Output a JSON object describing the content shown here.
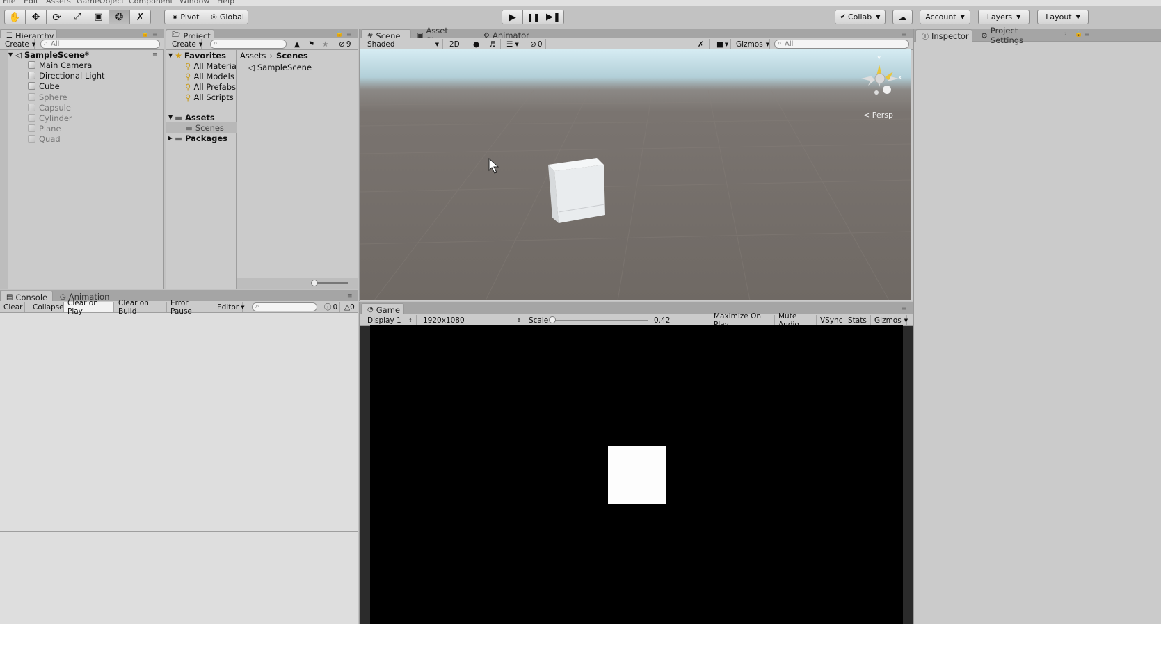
{
  "menu": [
    "File",
    "Edit",
    "Assets",
    "GameObject",
    "Component",
    "Window",
    "Help"
  ],
  "toolbar": {
    "pivot": "Pivot",
    "global": "Global",
    "collab": "Collab",
    "account": "Account",
    "layers": "Layers",
    "layout": "Layout"
  },
  "hierarchy": {
    "tab": "Hierarchy",
    "create": "Create",
    "search_placeholder": "All",
    "scene": "SampleScene*",
    "items": [
      {
        "label": "Main Camera",
        "active": true
      },
      {
        "label": "Directional Light",
        "active": true
      },
      {
        "label": "Cube",
        "active": true
      },
      {
        "label": "Sphere",
        "active": false
      },
      {
        "label": "Capsule",
        "active": false
      },
      {
        "label": "Cylinder",
        "active": false
      },
      {
        "label": "Plane",
        "active": false
      },
      {
        "label": "Quad",
        "active": false
      }
    ]
  },
  "project": {
    "tab": "Project",
    "create": "Create",
    "hidden_count": "9",
    "favorites": "Favorites",
    "favorite_items": [
      "All Materia",
      "All Models",
      "All Prefabs",
      "All Scripts"
    ],
    "assets": "Assets",
    "scenes_folder": "Scenes",
    "packages": "Packages",
    "breadcrumb": [
      "Assets",
      "Scenes"
    ],
    "content": [
      "SampleScene"
    ]
  },
  "console": {
    "tab": "Console",
    "animation_tab": "Animation",
    "buttons": [
      "Clear",
      "Collapse",
      "Clear on Play",
      "Clear on Build",
      "Error Pause",
      "Editor"
    ],
    "error_count": "0",
    "warn_count": "0"
  },
  "scene": {
    "tabs": [
      "Scene",
      "Asset Store",
      "Animator"
    ],
    "shading": "Shaded",
    "mode2d": "2D",
    "hidden": "0",
    "gizmos": "Gizmos",
    "search_placeholder": "All",
    "persp": "Persp",
    "gizmo_y": "y",
    "gizmo_x": "x"
  },
  "game": {
    "tab": "Game",
    "display": "Display 1",
    "resolution": "1920x1080",
    "scale_label": "Scale",
    "scale_value": "0.42",
    "scale_fraction": 0.0,
    "buttons": [
      "Maximize On Play",
      "Mute Audio",
      "VSync",
      "Stats",
      "Gizmos"
    ]
  },
  "inspector": {
    "tab": "Inspector",
    "project_settings_tab": "Project Settings"
  },
  "colors": {
    "editor_bg": "#c2c2c2",
    "panel_bg": "#cbcbcb",
    "selection": "#b8b8b8",
    "game_bg": "#000000"
  }
}
